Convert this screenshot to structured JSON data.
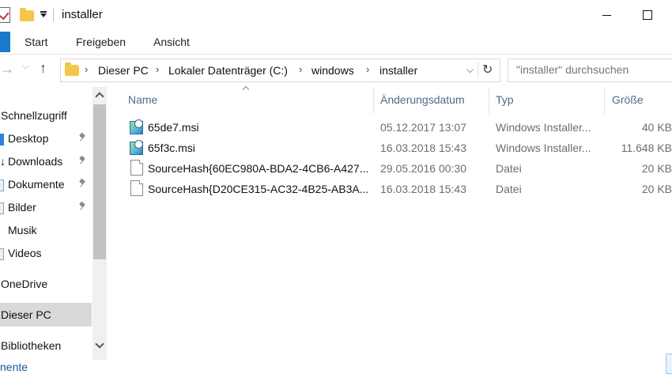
{
  "window": {
    "title": "installer"
  },
  "ribbon": {
    "tabs": [
      "Start",
      "Freigeben",
      "Ansicht"
    ]
  },
  "address": {
    "crumbs": [
      "Dieser PC",
      "Lokaler Datenträger (C:)",
      "windows",
      "installer"
    ],
    "search_placeholder": "\"installer\" durchsuchen"
  },
  "nav": {
    "items": [
      {
        "label": "Schnellzugriff"
      },
      {
        "label": "Desktop"
      },
      {
        "label": "Downloads"
      },
      {
        "label": "Dokumente"
      },
      {
        "label": "Bilder"
      },
      {
        "label": "Musik"
      },
      {
        "label": "Videos"
      },
      {
        "label": "OneDrive"
      },
      {
        "label": "Dieser PC"
      },
      {
        "label": "Bibliotheken"
      }
    ]
  },
  "columns": {
    "name": "Name",
    "date": "Änderungsdatum",
    "type": "Typ",
    "size": "Größe"
  },
  "files": [
    {
      "name": "65de7.msi",
      "date": "05.12.2017 13:07",
      "type": "Windows Installer...",
      "size": "40 KB",
      "icon": "msi-installer-icon"
    },
    {
      "name": "65f3c.msi",
      "date": "16.03.2018 15:43",
      "type": "Windows Installer...",
      "size": "11.648 KB",
      "icon": "msi-installer-icon"
    },
    {
      "name": "SourceHash{60EC980A-BDA2-4CB6-A427...",
      "date": "29.05.2016 00:30",
      "type": "Datei",
      "size": "20 KB",
      "icon": "file-icon"
    },
    {
      "name": "SourceHash{D20CE315-AC32-4B25-AB3A...",
      "date": "16.03.2018 15:43",
      "type": "Datei",
      "size": "20 KB",
      "icon": "file-icon"
    }
  ],
  "status": {
    "text": "nente"
  }
}
